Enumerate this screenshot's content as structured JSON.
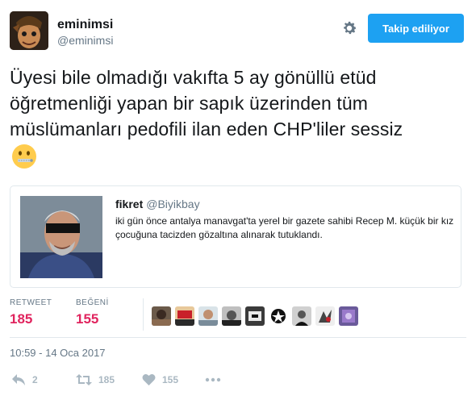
{
  "user": {
    "display_name": "eminimsi",
    "handle": "@eminimsi"
  },
  "follow_button": {
    "label": "Takip ediliyor"
  },
  "tweet": {
    "text": "Üyesi bile olmadığı vakıfta 5 ay gönüllü etüd öğretmenliği yapan bir sapık üzerinden tüm müslümanları pedofili ilan eden CHP'liler sessiz",
    "emoji": "zipper-mouth-face"
  },
  "quoted_tweet": {
    "name": "fikret",
    "handle": "@Biyikbay",
    "text": "iki gün önce antalya manavgat'ta yerel bir gazete sahibi Recep M. küçük bir kız çocuğuna tacizden gözaltına alınarak tutuklandı."
  },
  "stats": {
    "retweet_label": "RETWEET",
    "retweet_count": "185",
    "likes_label": "BEĞENİ",
    "likes_count": "155",
    "liker_count": 9
  },
  "timestamp": "10:59 - 14 Oca 2017",
  "actions": {
    "reply_count": "2",
    "retweet_count": "185",
    "like_count": "155"
  },
  "colors": {
    "accent": "#1da1f2",
    "stat_value": "#e0245e",
    "muted": "#657786",
    "action_icon": "#aab8c2"
  }
}
